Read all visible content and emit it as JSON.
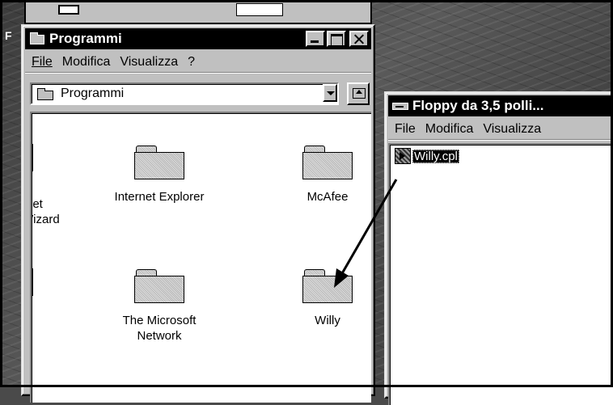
{
  "programmi_window": {
    "title": "Programmi",
    "menu": [
      "File",
      "Modifica",
      "Visualizza",
      "?"
    ],
    "address_value": "Programmi",
    "items": [
      {
        "label1": "rnet",
        "label2": "Wizard"
      },
      {
        "label1": "Internet Explorer",
        "label2": ""
      },
      {
        "label1": "McAfee",
        "label2": ""
      },
      {
        "label1": "The Microsoft",
        "label2": "Network"
      },
      {
        "label1": "Willy",
        "label2": ""
      }
    ]
  },
  "floppy_window": {
    "title": "Floppy da 3,5 polli...",
    "menu": [
      "File",
      "Modifica",
      "Visualizza"
    ],
    "file_label": "Willy.cpl"
  },
  "colors": {
    "titlebar": "#000000",
    "window_face": "#c0c0c0",
    "content_bg": "#ffffff"
  },
  "icons": [
    "folder-icon",
    "drive-icon",
    "cpl-file-icon",
    "up-folder-icon",
    "drag-arrow-icon"
  ]
}
